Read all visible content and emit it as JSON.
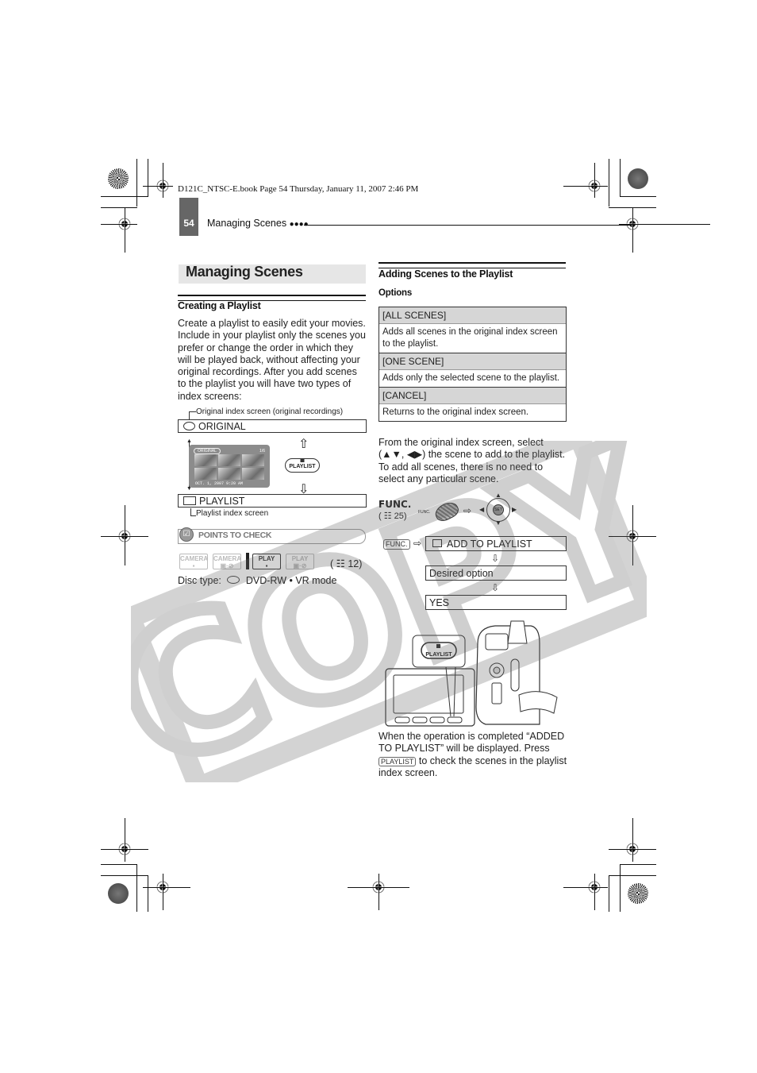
{
  "slug": "D121C_NTSC-E.book  Page 54  Thursday, January 11, 2007  2:46 PM",
  "running_head": {
    "page_number": "54",
    "section": "Managing Scenes",
    "dots": "●●●●"
  },
  "left": {
    "title": "Managing Scenes",
    "subheading": "Creating a Playlist",
    "body": "Create a playlist to easily edit your movies. Include in your playlist only the scenes you prefer or change the order in which they will be played back, without affecting your original recordings. After you add scenes to the playlist you will have two types of index screens:",
    "original_caption": "Original index screen (original recordings)",
    "original_label": "ORIGINAL",
    "playlist_label": "PLAYLIST",
    "playlist_caption": "Playlist index screen",
    "screen": {
      "tag": "ORIGINAL",
      "counter": "1/6",
      "datetime": "OCT. 1, 2007   9:20 AM"
    },
    "playlist_button": "PLAYLIST",
    "arrow_up": "⇧",
    "arrow_down": "⇩",
    "points_to_check": "POINTS TO CHECK",
    "modes": [
      {
        "label": "CAMERA",
        "sub": "▪",
        "active": false
      },
      {
        "label": "CAMERA",
        "sub": "▣·⊘",
        "active": false
      },
      {
        "label": "PLAY",
        "sub": "▪",
        "active": true
      },
      {
        "label": "PLAY",
        "sub": "▣·⊘",
        "active": false
      }
    ],
    "mode_ref": "( ☷ 12)",
    "disc_type_label": "Disc type:",
    "disc_type_value": "DVD-RW • VR mode"
  },
  "right": {
    "subheading": "Adding Scenes to the Playlist",
    "options_heading": "Options",
    "options": [
      {
        "name": "[ALL SCENES]",
        "desc": "Adds all scenes in the original index screen to the playlist."
      },
      {
        "name": "[ONE SCENE]",
        "desc": "Adds only the selected scene to the playlist."
      },
      {
        "name": "[CANCEL]",
        "desc": "Returns to the original index screen."
      }
    ],
    "instruction": "From the original index screen, select (▲▼, ◀▶) the scene to add to the playlist. To add all scenes, there is no need to select any particular scene.",
    "func_label": "FUNC.",
    "func_ref": "( ☷ 25)",
    "func_small": "FUNC.",
    "joystick_label": "SET",
    "flow": {
      "func_key": "FUNC.",
      "arrow": "⇨",
      "steps": [
        "ADD TO PLAYLIST",
        "Desired option",
        "YES"
      ],
      "down_arrow": "⇩"
    },
    "camera_button": "PLAYLIST",
    "completion_text_1": "When the operation is completed “ADDED TO PLAYLIST” will be displayed. Press",
    "completion_key": "PLAYLIST",
    "completion_text_2": "to check the scenes in the playlist index screen."
  },
  "watermark": "COPY"
}
